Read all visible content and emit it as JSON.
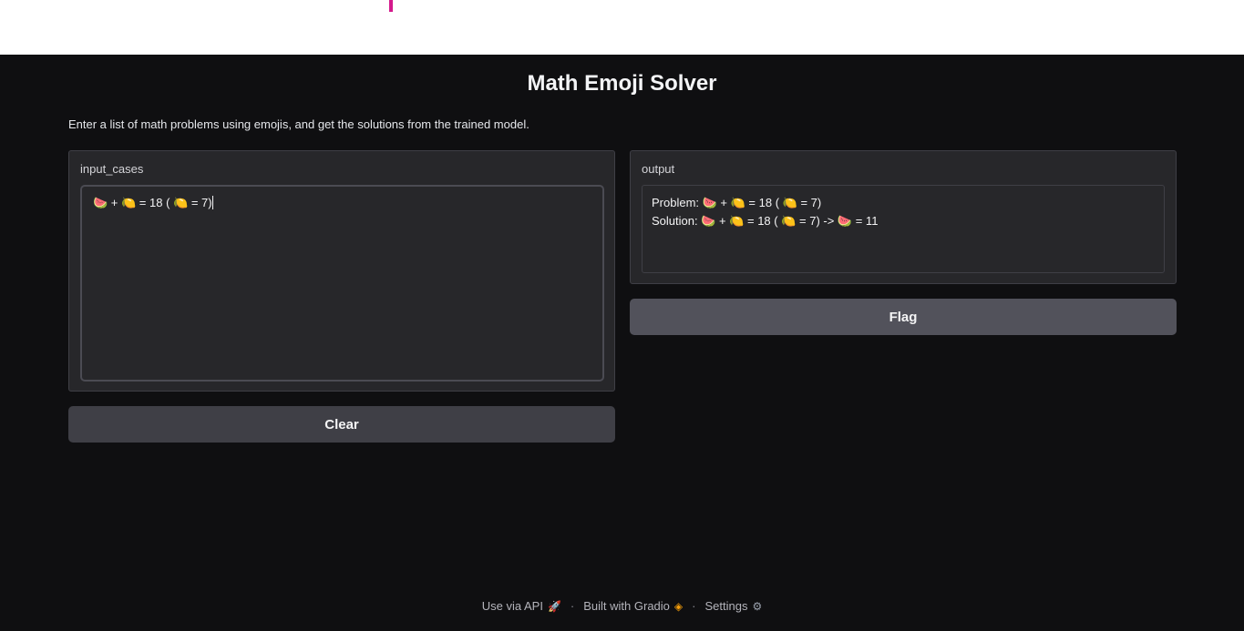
{
  "header": {
    "title": "Math Emoji Solver",
    "description": "Enter a list of math problems using emojis, and get the solutions from the trained model."
  },
  "input_panel": {
    "label": "input_cases",
    "value": "🍉 + 🍋 = 18 ( 🍋 = 7)"
  },
  "output_panel": {
    "label": "output",
    "lines": [
      "Problem: 🍉 + 🍋 = 18 ( 🍋 = 7)",
      "Solution: 🍉 + 🍋 = 18 ( 🍋 = 7) -> 🍉 = 11"
    ]
  },
  "buttons": {
    "clear_label": "Clear",
    "flag_label": "Flag"
  },
  "footer": {
    "api_label": "Use via API",
    "built_label": "Built with Gradio",
    "settings_label": "Settings",
    "separator": "·",
    "icons": [
      "rocket-icon",
      "gradio-logo-icon",
      "gear-icon"
    ]
  },
  "colors": {
    "background": "#0f0f11",
    "panel": "#27272a",
    "accent_mark": "#d4198c"
  }
}
